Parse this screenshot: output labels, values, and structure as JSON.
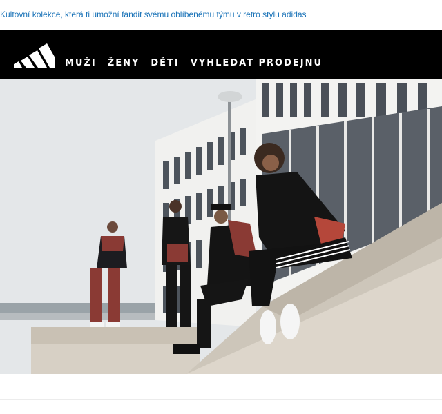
{
  "preheader": {
    "text": "Kultovní kolekce, která ti umožní fandit svému oblíbenému týmu v retro stylu adidas"
  },
  "header": {
    "logo_icon": "adidas-performance-logo",
    "nav": [
      {
        "label": "MUŽI"
      },
      {
        "label": "ŽENY"
      },
      {
        "label": "DĚTI"
      },
      {
        "label": "VYHLEDAT PRODEJNU"
      }
    ]
  },
  "hero": {
    "image": "photo: four people in adidas tracksuits posed on urban concrete steps in front of modern white buildings",
    "colors": {
      "sky": "#e4e7e9",
      "building": "#f0f0ee",
      "window": "#4a5058",
      "concrete": "#cfc8bd",
      "maroon": "#8a3a34",
      "black": "#151515"
    }
  }
}
